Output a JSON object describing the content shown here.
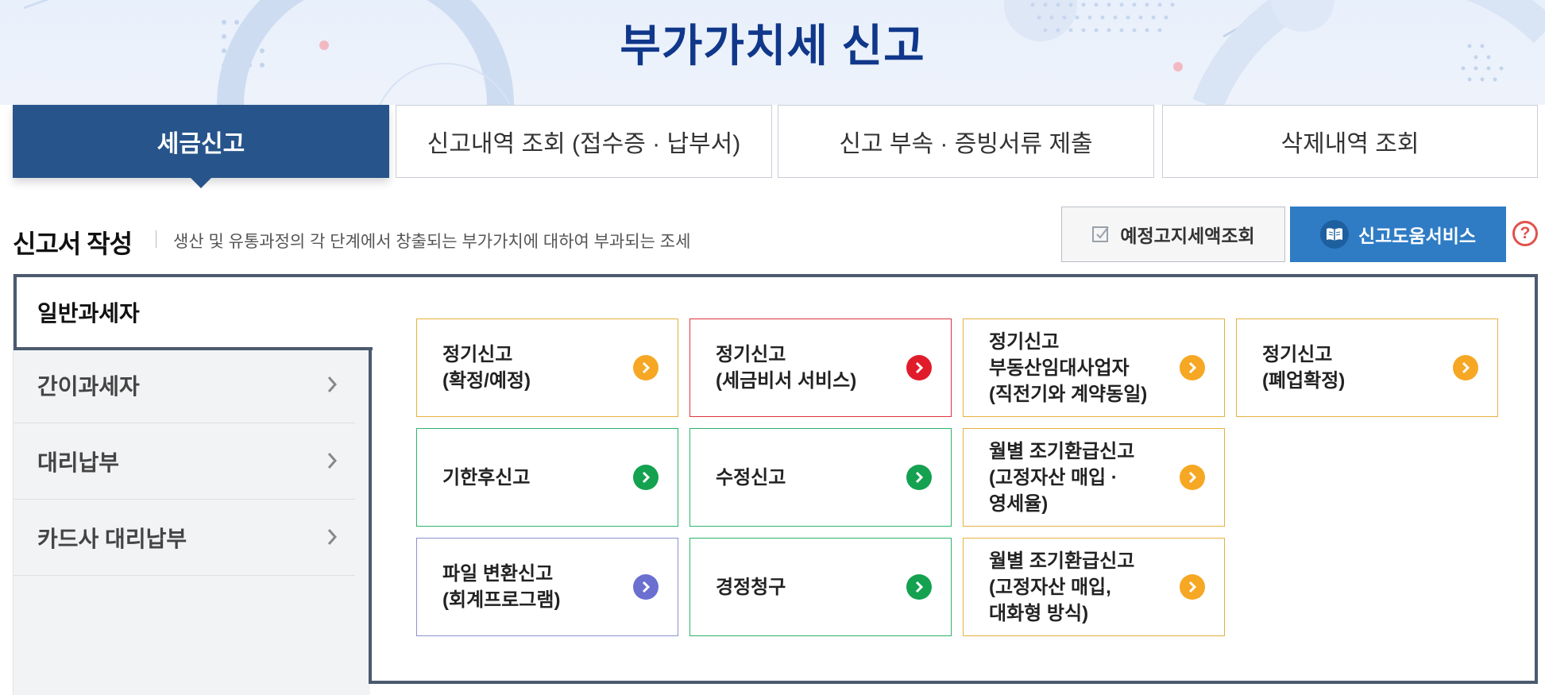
{
  "header": {
    "title": "부가가치세 신고"
  },
  "tabs": [
    {
      "label": "세금신고",
      "active": true
    },
    {
      "label": "신고내역 조회 (접수증 · 납부서)",
      "active": false
    },
    {
      "label": "신고 부속 · 증빙서류 제출",
      "active": false
    },
    {
      "label": "삭제내역 조회",
      "active": false
    }
  ],
  "section": {
    "title": "신고서 작성",
    "description": "생산 및 유통과정의 각 단계에서 창출되는 부가가치에 대하여 부과되는 조세",
    "estimate_button": "예정고지세액조회",
    "help_service_button": "신고도움서비스",
    "help_icon": "?"
  },
  "sidebar": {
    "items": [
      {
        "label": "일반과세자",
        "active": true
      },
      {
        "label": "간이과세자",
        "active": false
      },
      {
        "label": "대리납부",
        "active": false
      },
      {
        "label": "카드사 대리납부",
        "active": false
      }
    ]
  },
  "cards": [
    {
      "label": "정기신고\n(확정/예정)",
      "color": "orange"
    },
    {
      "label": "정기신고\n(세금비서 서비스)",
      "color": "red"
    },
    {
      "label": "정기신고\n부동산임대사업자\n(직전기와 계약동일)",
      "color": "orange"
    },
    {
      "label": "정기신고\n(폐업확정)",
      "color": "orange"
    },
    {
      "label": "기한후신고",
      "color": "green"
    },
    {
      "label": "수정신고",
      "color": "green"
    },
    {
      "label": "월별 조기환급신고\n(고정자산 매입 ·\n영세율)",
      "color": "orange"
    },
    {
      "label": "파일 변환신고\n(회계프로그램)",
      "color": "purple"
    },
    {
      "label": "경정청구",
      "color": "green"
    },
    {
      "label": "월별 조기환급신고\n(고정자산 매입,\n대화형 방식)",
      "color": "orange"
    }
  ],
  "colors": {
    "brand_title": "#10378a",
    "active_tab": "#27548b",
    "help_service": "#2f7cc5",
    "orange": "#f6a723",
    "red": "#e01c2a",
    "green": "#14a150",
    "purple": "#6a6fd0"
  },
  "icons": {
    "estimate": "checkbox-icon",
    "help_service": "book-icon",
    "help": "question-icon",
    "card_arrow": "chevron-right-icon",
    "sidebar_arrow": "chevron-right-icon"
  }
}
